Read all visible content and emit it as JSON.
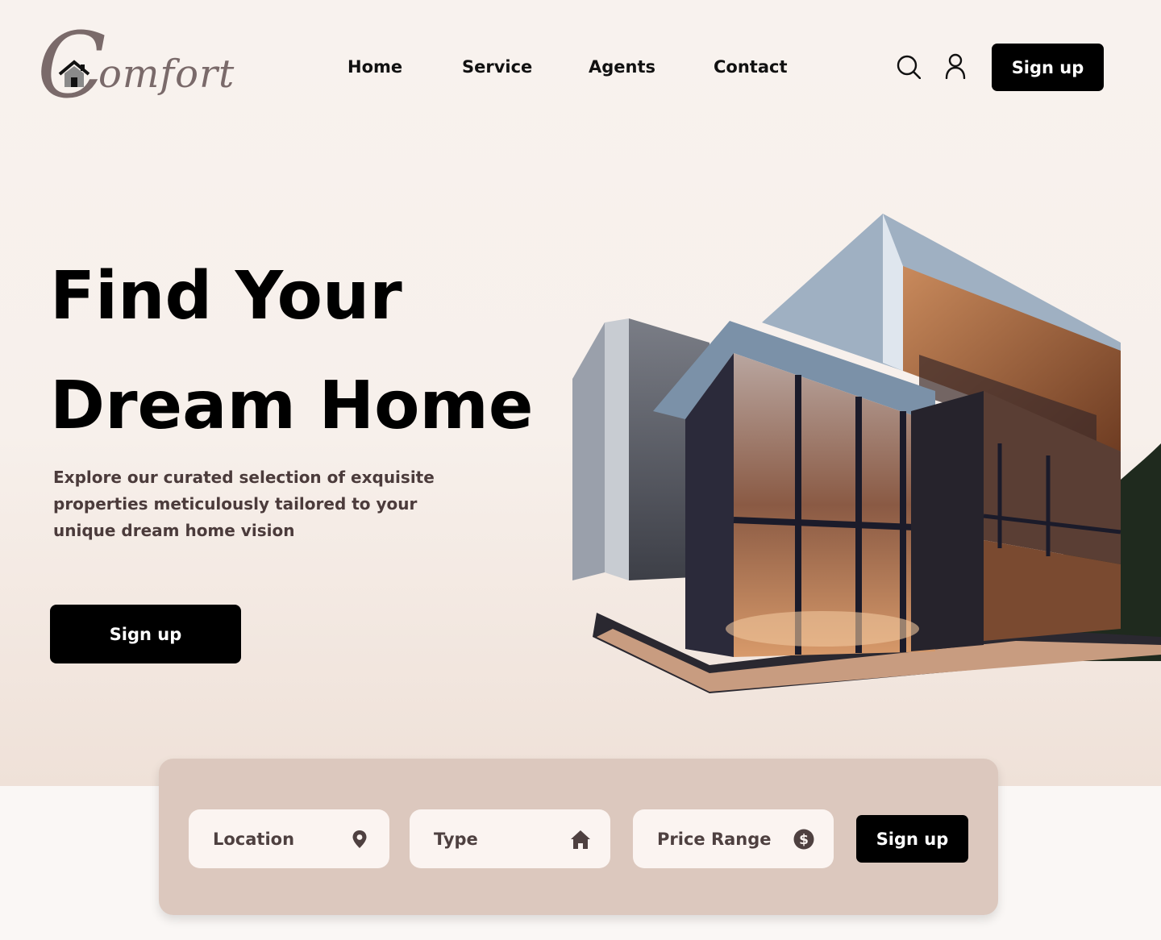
{
  "logo": {
    "letter": "C",
    "text": "omfort",
    "color": "#7a6a6a"
  },
  "nav": {
    "items": [
      {
        "label": "Home"
      },
      {
        "label": "Service"
      },
      {
        "label": "Agents"
      },
      {
        "label": "Contact"
      }
    ]
  },
  "header": {
    "search_icon": "search-icon",
    "user_icon": "user-icon",
    "signup_label": "Sign up"
  },
  "hero": {
    "title_line1": "Find Your",
    "title_line2": "Dream Home",
    "description": "Explore our curated selection of exquisite properties meticulously tailored to your unique dream home vision",
    "cta_label": "Sign up"
  },
  "search": {
    "location_label": "Location",
    "location_icon": "map-pin-icon",
    "type_label": "Type",
    "type_icon": "home-icon",
    "price_label": "Price Range",
    "price_icon": "dollar-icon",
    "submit_label": "Sign up"
  },
  "colors": {
    "accent": "#000000",
    "panel": "#dcc8be",
    "field": "#fbf4f1",
    "background": "#f8f2ee"
  }
}
